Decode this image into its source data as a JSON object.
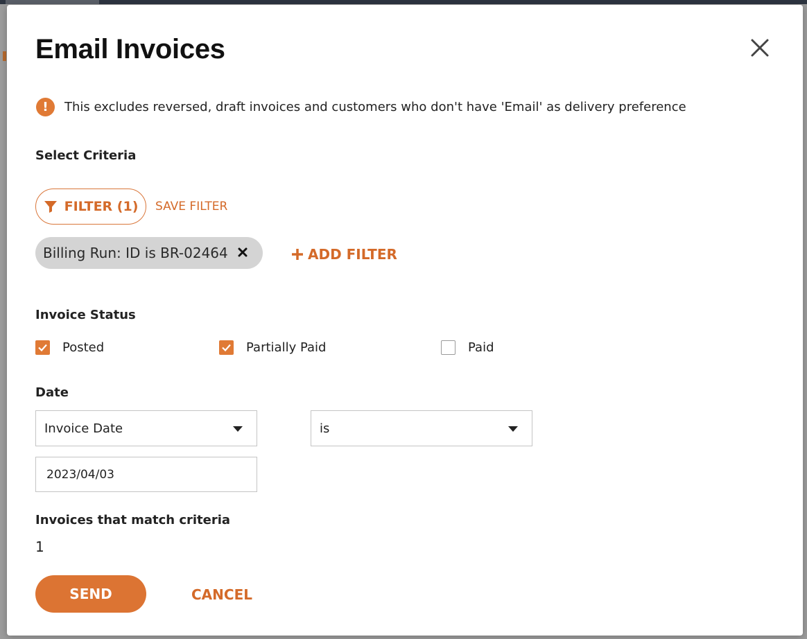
{
  "modal": {
    "title": "Email Invoices",
    "notice": "This excludes reversed, draft invoices and customers who don't have 'Email' as delivery preference"
  },
  "criteria": {
    "label": "Select Criteria",
    "filter_button": "FILTER (1)",
    "save_filter": "SAVE FILTER",
    "active_filter_chip": "Billing Run: ID is BR-02464",
    "add_filter": "ADD FILTER"
  },
  "invoice_status": {
    "label": "Invoice Status",
    "options": [
      {
        "label": "Posted",
        "checked": true
      },
      {
        "label": "Partially Paid",
        "checked": true
      },
      {
        "label": "Paid",
        "checked": false
      }
    ]
  },
  "date": {
    "label": "Date",
    "field_select": "Invoice Date",
    "operator_select": "is",
    "value": "2023/04/03"
  },
  "match": {
    "label": "Invoices that match criteria",
    "count": "1"
  },
  "actions": {
    "send": "SEND",
    "cancel": "CANCEL"
  },
  "colors": {
    "accent": "#dc7433",
    "chip_bg": "#d4d4d4"
  },
  "icons": {
    "notice": "exclamation-circle-icon",
    "filter": "funnel-icon",
    "close": "close-icon",
    "chip_remove": "x-icon",
    "add": "plus-icon",
    "dropdown": "caret-down-icon",
    "check": "checkmark-icon"
  }
}
